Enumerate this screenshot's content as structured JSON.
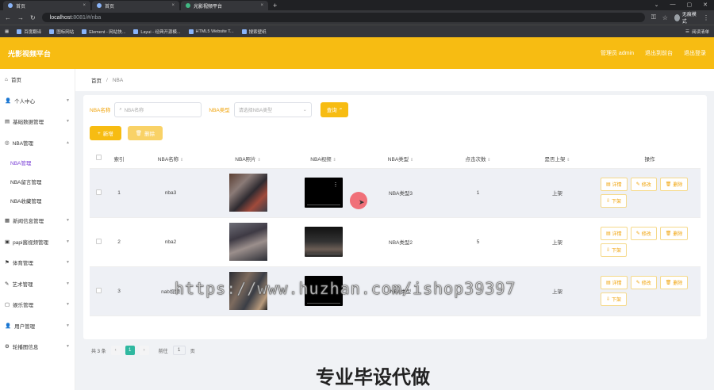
{
  "browser": {
    "tabs": [
      {
        "title": "首页",
        "active": false
      },
      {
        "title": "首页",
        "active": false
      },
      {
        "title": "光影视频平台",
        "active": true
      }
    ],
    "url_host": "localhost",
    "url_path": ":8081/#/nba",
    "profile": "无痕模式",
    "bookmarks": [
      "百度翻译",
      "图标网站",
      "Element - 网站快...",
      "Layui - 经典开源模...",
      "HTML5 Website T...",
      "搜索壁纸"
    ],
    "bookmarks_right": "阅读清单"
  },
  "header": {
    "brand": "光影视频平台",
    "user": "管理员 admin",
    "exit_system": "退出到前台",
    "logout": "退出登录"
  },
  "sidebar": {
    "items": [
      {
        "label": "首页"
      },
      {
        "label": "个人中心"
      },
      {
        "label": "基础数据管理"
      },
      {
        "label": "NBA管理"
      }
    ],
    "subitems": [
      {
        "label": "NBA管理",
        "active": true
      },
      {
        "label": "NBA留言管理",
        "active": false
      },
      {
        "label": "NBA收藏管理",
        "active": false
      }
    ],
    "items_after": [
      {
        "label": "新闻信息管理"
      },
      {
        "label": "papi酱视频管理"
      },
      {
        "label": "体育管理"
      },
      {
        "label": "艺术管理"
      },
      {
        "label": "娱乐管理"
      },
      {
        "label": "用户管理"
      },
      {
        "label": "轮播图信息"
      }
    ]
  },
  "breadcrumb": {
    "home": "首页",
    "sep": "/",
    "current": "NBA"
  },
  "search": {
    "name_label": "NBA名称",
    "name_placeholder": "NBA名称",
    "type_label": "NBA类型",
    "type_placeholder": "请选择NBA类型",
    "query_button": "查询"
  },
  "actions": {
    "add": "新增",
    "delete": "删除"
  },
  "table": {
    "headers": [
      "索引",
      "NBA名称",
      "NBA照片",
      "NBA视频",
      "NBA类型",
      "点击次数",
      "是否上架",
      "操作"
    ],
    "rows": [
      {
        "index": "1",
        "name": "nba3",
        "type": "NBA类型3",
        "clicks": "1",
        "status": "上架"
      },
      {
        "index": "2",
        "name": "nba2",
        "type": "NBA类型2",
        "clicks": "5",
        "status": "上架"
      },
      {
        "index": "3",
        "name": "nab视频",
        "type": "NBA类型",
        "clicks": "",
        "status": "上架"
      }
    ],
    "op_labels": {
      "detail": "详情",
      "edit": "修改",
      "delete": "删除",
      "offshelf": "下架"
    }
  },
  "pager": {
    "total": "共 3 条",
    "current": "1",
    "goto": "前往",
    "page_value": "1",
    "page_unit": "页"
  },
  "overlay": {
    "watermark": "https://www.huzhan.com/ishop39397",
    "caption": "专业毕设代做"
  }
}
